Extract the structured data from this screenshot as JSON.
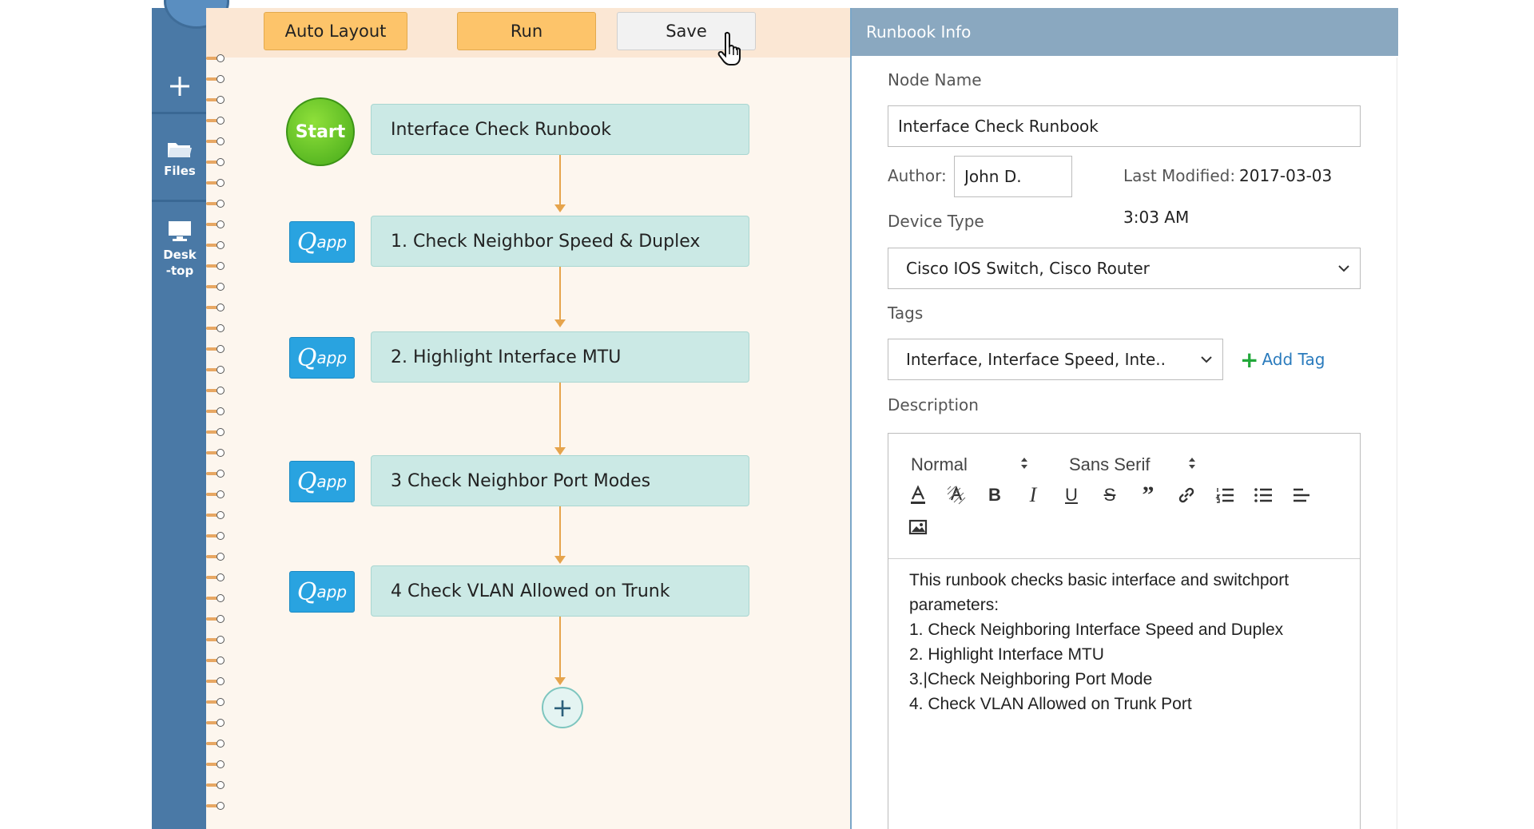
{
  "sidebar": {
    "add_icon": "plus-icon",
    "files_label": "Files",
    "desktop_label": "Desk\n-top"
  },
  "toolbar": {
    "auto_layout_label": "Auto Layout",
    "run_label": "Run",
    "save_label": "Save"
  },
  "flow": {
    "start_label": "Start",
    "root_node": "Interface Check Runbook",
    "qapp_q": "Q",
    "qapp_suffix": "app",
    "nodes": [
      "1. Check Neighbor Speed & Duplex",
      "2. Highlight Interface MTU",
      "3 Check Neighbor Port Modes",
      "4 Check VLAN Allowed on Trunk"
    ],
    "add_label": "+"
  },
  "panel": {
    "title": "Runbook Info",
    "node_name_label": "Node Name",
    "node_name_value": "Interface Check Runbook",
    "author_label": "Author:",
    "author_value": "John D.",
    "last_modified_label": "Last Modified:",
    "last_modified_date": "2017-03-03",
    "last_modified_time": "3:03 AM",
    "device_type_label": "Device Type",
    "device_type_value": "Cisco IOS Switch, Cisco Router",
    "tags_label": "Tags",
    "tags_value": "Interface, Interface Speed, Inte..",
    "add_tag_label": "Add Tag",
    "description_label": "Description",
    "editor": {
      "paragraph_style": "Normal",
      "font_family": "Sans Serif",
      "content": [
        "This runbook checks basic interface and switchport",
        "parameters:",
        "1. Check Neighboring Interface Speed and Duplex",
        "2. Highlight Interface MTU",
        "3.|Check Neighboring Port Mode",
        "4. Check VLAN Allowed on Trunk Port"
      ]
    }
  },
  "colors": {
    "sidebar": "#4a79a6",
    "toolbar_orange": "#fdc46a",
    "node_fill": "#cbe9e5",
    "qapp_blue": "#29a3e0",
    "start_green": "#45a91a",
    "connector": "#e6a44c",
    "panel_header": "#8aa8c0",
    "add_tag_green": "#22a83a"
  }
}
